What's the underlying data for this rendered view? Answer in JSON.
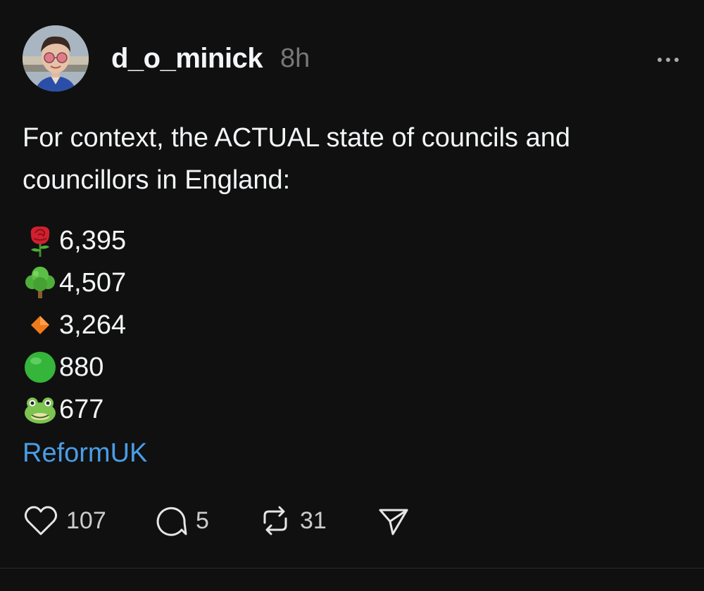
{
  "post": {
    "author": {
      "username": "d_o_minick"
    },
    "timestamp": "8h",
    "text": "For context, the ACTUAL state of councils and councillors in England:",
    "stats": [
      {
        "icon": "rose-icon",
        "value": "6,395"
      },
      {
        "icon": "deciduous-tree-icon",
        "value": "4,507"
      },
      {
        "icon": "orange-diamond-icon",
        "value": "3,264"
      },
      {
        "icon": "green-circle-icon",
        "value": "880"
      },
      {
        "icon": "frog-face-icon",
        "value": "677"
      }
    ],
    "tag": "ReformUK",
    "actions": {
      "likes": "107",
      "replies": "5",
      "reposts": "31"
    }
  },
  "colors": {
    "background": "#101010",
    "text": "#f3f5f7",
    "muted": "#777777",
    "link": "#4a9de6"
  }
}
